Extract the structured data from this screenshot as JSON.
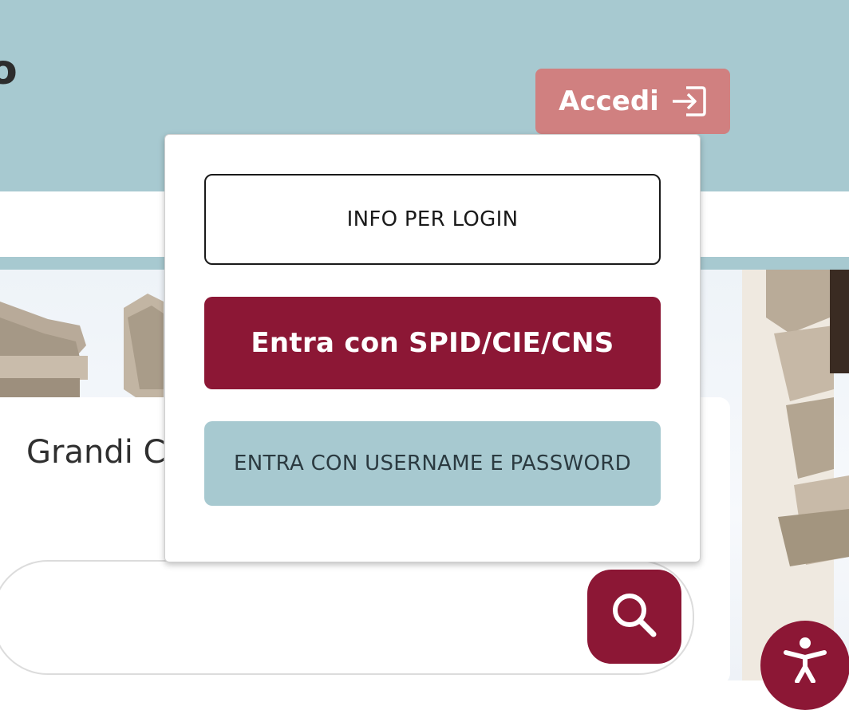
{
  "header": {
    "logo_fragment": "o",
    "login_button_label": "Accedi"
  },
  "login_menu": {
    "info_label": "INFO PER LOGIN",
    "spid_label": "Entra con SPID/CIE/CNS",
    "userpass_label": "ENTRA CON USERNAME E PASSWORD"
  },
  "card": {
    "title": "Grandi Ca"
  },
  "search": {
    "placeholder": "",
    "icon": "search-icon"
  },
  "accessibility": {
    "icon": "accessibility-icon"
  },
  "colors": {
    "header_bg": "#a7c9d0",
    "login_button_bg": "#d08080",
    "primary": "#8c1735",
    "secondary": "#a7c9d0"
  }
}
